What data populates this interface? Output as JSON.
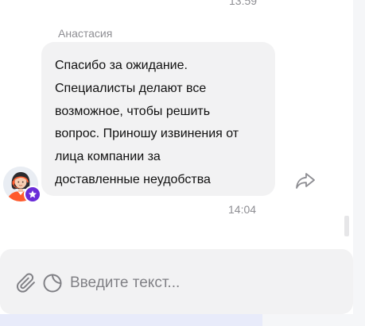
{
  "chat": {
    "previous_time": "13:59",
    "message": {
      "sender": "Анастасия",
      "text_lines": [
        "Спасибо за ожидание.",
        "Специалисты делают все",
        "возможное, чтобы решить",
        "вопрос. Приношу извинения от",
        "лица компании за",
        "доставленные неудобства"
      ],
      "time": "14:04"
    }
  },
  "composer": {
    "placeholder": "Введите текст..."
  },
  "colors": {
    "bubble": "#f2f2f3",
    "badge": "#6a2cd8",
    "muted_text": "#8e8e93"
  },
  "icons": {
    "avatar_badge": "star-icon",
    "forward": "share-arrow-icon",
    "attach": "paperclip-icon",
    "sticker": "sticker-icon"
  }
}
